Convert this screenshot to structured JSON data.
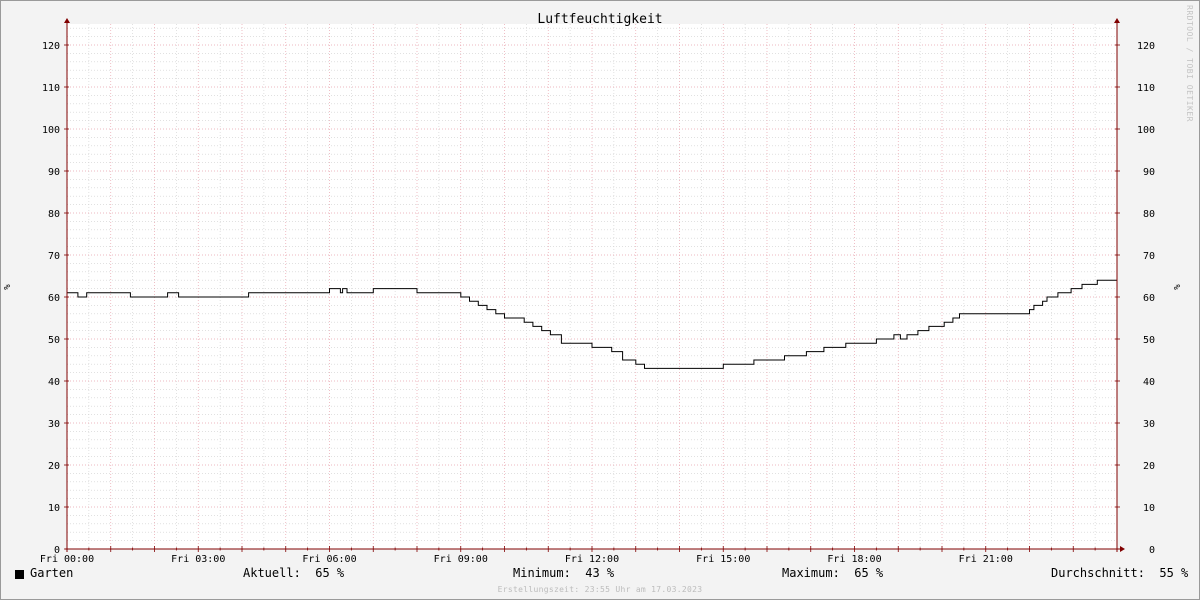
{
  "chart_data": {
    "type": "line",
    "title": "Luftfeuchtigkeit",
    "ylabel": "%",
    "ylim": [
      0,
      125
    ],
    "yticks": [
      0,
      10,
      20,
      30,
      40,
      50,
      60,
      70,
      80,
      90,
      100,
      110,
      120
    ],
    "xlim": [
      0,
      24
    ],
    "xticks": [
      {
        "x": 0,
        "label": "Fri 00:00"
      },
      {
        "x": 3,
        "label": "Fri 03:00"
      },
      {
        "x": 6,
        "label": "Fri 06:00"
      },
      {
        "x": 9,
        "label": "Fri 09:00"
      },
      {
        "x": 12,
        "label": "Fri 12:00"
      },
      {
        "x": 15,
        "label": "Fri 15:00"
      },
      {
        "x": 18,
        "label": "Fri 18:00"
      },
      {
        "x": 21,
        "label": "Fri 21:00"
      }
    ],
    "grid": true,
    "series": [
      {
        "name": "Garten",
        "color": "#000000",
        "x": [
          0.0,
          0.25,
          0.3,
          0.45,
          1.4,
          1.45,
          2.3,
          2.55,
          4.15,
          5.8,
          6.0,
          6.05,
          6.25,
          6.3,
          6.4,
          6.6,
          7.0,
          7.9,
          8.0,
          8.85,
          9.0,
          9.2,
          9.4,
          9.6,
          9.8,
          10.0,
          10.2,
          10.45,
          10.65,
          10.85,
          11.05,
          11.3,
          12.0,
          12.3,
          12.45,
          12.7,
          13.0,
          13.2,
          13.7,
          14.3,
          15.0,
          15.2,
          15.7,
          16.0,
          16.4,
          16.9,
          17.3,
          17.8,
          18.1,
          18.5,
          18.9,
          19.05,
          19.1,
          19.2,
          19.45,
          19.7,
          20.05,
          20.25,
          20.4,
          20.55,
          21.15,
          22.0,
          22.1,
          22.2,
          22.3,
          22.4,
          22.5,
          22.65,
          22.95,
          23.2,
          23.55,
          24.0
        ],
        "y": [
          61,
          60,
          60,
          61,
          61,
          60,
          61,
          60,
          61,
          61,
          62,
          62,
          61,
          62,
          61,
          61,
          62,
          62,
          61,
          61,
          60,
          59,
          58,
          57,
          56,
          55,
          55,
          54,
          53,
          52,
          51,
          49,
          48,
          48,
          47,
          45,
          44,
          43,
          43,
          43,
          44,
          44,
          45,
          45,
          46,
          47,
          48,
          49,
          49,
          50,
          51,
          50,
          50,
          51,
          52,
          53,
          54,
          55,
          56,
          56,
          56,
          57,
          58,
          58,
          59,
          60,
          60,
          61,
          62,
          63,
          64,
          65
        ]
      }
    ],
    "axis_color": "#800000",
    "grid_major_color": "#e9a4ad",
    "grid_minor_color": "#cfcfcf",
    "background": "#ffffff",
    "canvas_border": "#f3f3f3"
  },
  "legend": {
    "series_name": "Garten",
    "current_label": "Aktuell:",
    "current_value": "65 %",
    "min_label": "Minimum:",
    "min_value": "43 %",
    "max_label": "Maximum:",
    "max_value": "65 %",
    "avg_label": "Durchschnitt:",
    "avg_value": "55 %"
  },
  "footer": "Erstellungszeit: 23:55 Uhr am 17.03.2023",
  "watermark": "RRDTOOL / TOBI OETIKER"
}
